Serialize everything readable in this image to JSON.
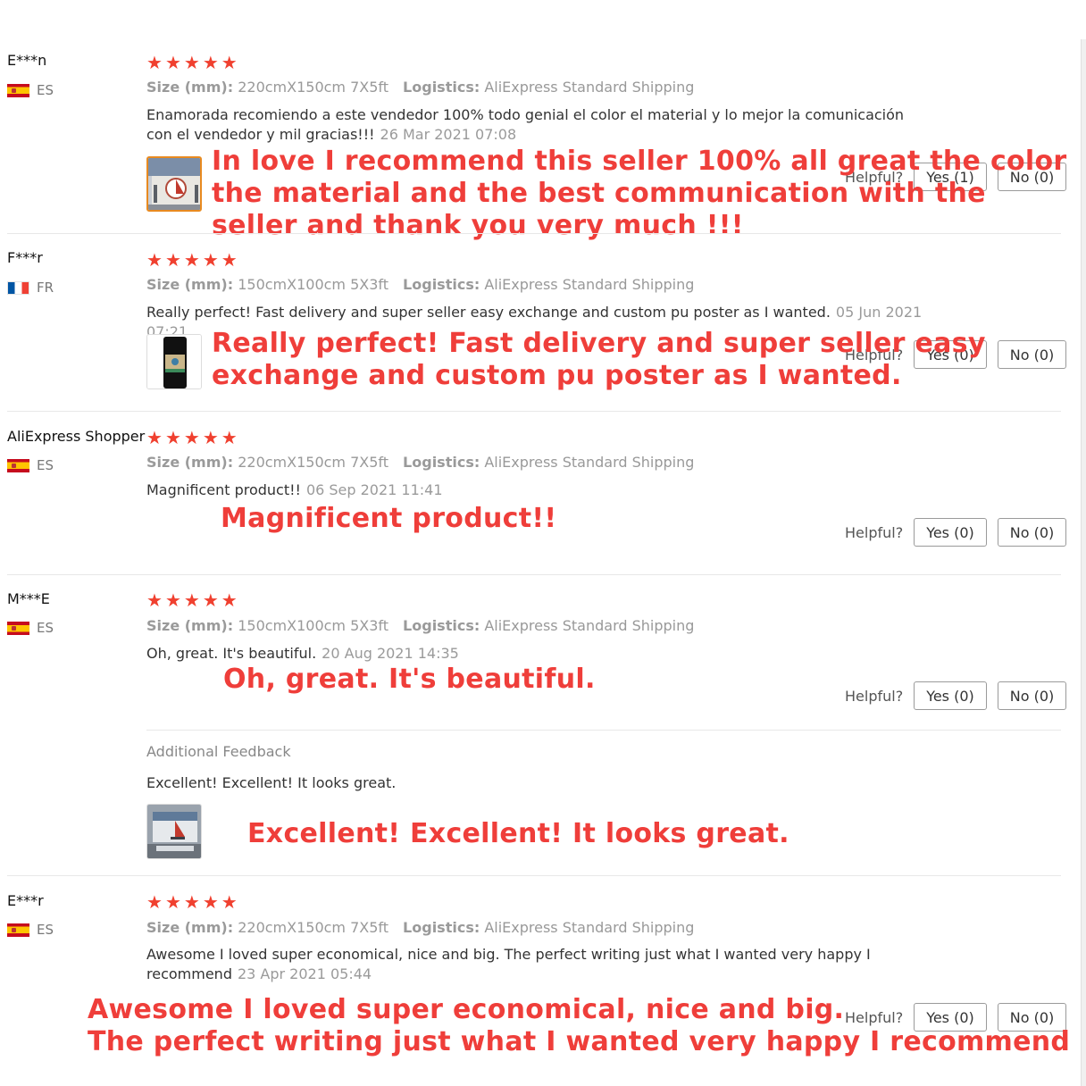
{
  "reviews": [
    {
      "user": "E***n",
      "country": "ES",
      "size_label": "Size (mm):",
      "size": "220cmX150cm 7X5ft",
      "logistics_label": "Logistics:",
      "logistics": "AliExpress Standard Shipping",
      "text": "Enamorada recomiendo a este vendedor 100% todo genial el color el material y lo mejor la comunicación con el vendedor y mil gracias!!!",
      "date": "26 Mar 2021 07:08",
      "helpful_label": "Helpful?",
      "yes": "Yes (1)",
      "no": "No (0)",
      "translation": "In love I recommend this seller 100% all great the color the material and the best communication with the seller and thank you very much !!!",
      "thumbnail": "product-photo-sailboat"
    },
    {
      "user": "F***r",
      "country": "FR",
      "size_label": "Size (mm):",
      "size": "150cmX100cm 5X3ft",
      "logistics_label": "Logistics:",
      "logistics": "AliExpress Standard Shipping",
      "text": "Really perfect! Fast delivery and super seller easy exchange and custom pu poster as I wanted.",
      "date": "05 Jun 2021 07:21",
      "helpful_label": "Helpful?",
      "yes": "Yes (0)",
      "no": "No (0)",
      "translation": "Really perfect! Fast delivery and super seller easy exchange and custom pu poster as I wanted.",
      "thumbnail": "product-photo-phone"
    },
    {
      "user": "AliExpress Shopper",
      "country": "ES",
      "size_label": "Size (mm):",
      "size": "220cmX150cm 7X5ft",
      "logistics_label": "Logistics:",
      "logistics": "AliExpress Standard Shipping",
      "text": "Magnificent product!!",
      "date": "06 Sep 2021 11:41",
      "helpful_label": "Helpful?",
      "yes": "Yes (0)",
      "no": "No (0)",
      "translation": "Magnificent product!!"
    },
    {
      "user": "M***E",
      "country": "ES",
      "size_label": "Size (mm):",
      "size": "150cmX100cm 5X3ft",
      "logistics_label": "Logistics:",
      "logistics": "AliExpress Standard Shipping",
      "text": "Oh, great. It's beautiful.",
      "date": "20 Aug 2021 14:35",
      "helpful_label": "Helpful?",
      "yes": "Yes (0)",
      "no": "No (0)",
      "translation": "Oh, great. It's beautiful.",
      "additional_title": "Additional Feedback",
      "additional_text": "Excellent! Excellent! It looks great.",
      "additional_translation": "Excellent! Excellent! It looks great.",
      "thumbnail": "product-photo-backdrop"
    },
    {
      "user": "E***r",
      "country": "ES",
      "size_label": "Size (mm):",
      "size": "220cmX150cm 7X5ft",
      "logistics_label": "Logistics:",
      "logistics": "AliExpress Standard Shipping",
      "text": "Awesome I loved super economical, nice and big. The perfect writing just what I wanted very happy I recommend",
      "date": "23 Apr 2021 05:44",
      "helpful_label": "Helpful?",
      "yes": "Yes (0)",
      "no": "No (0)",
      "translation_line1": "Awesome I loved super economical, nice and big.",
      "translation_line2": "The perfect writing just what I wanted very happy I recommend"
    }
  ],
  "rating_stars": 5,
  "colors": {
    "star": "#f0402f",
    "translation": "#ef3e3a",
    "thumb_selected_border": "#e88a20"
  }
}
